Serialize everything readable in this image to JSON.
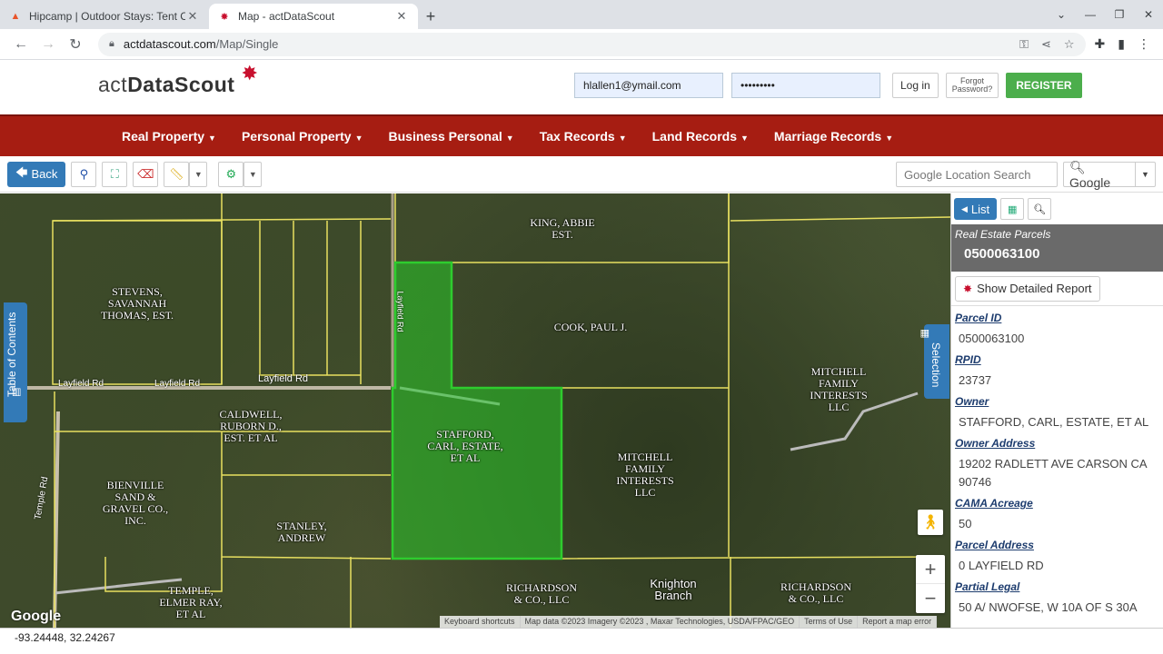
{
  "browser": {
    "tabs": [
      {
        "title": "Hipcamp | Outdoor Stays: Tent C",
        "active": false
      },
      {
        "title": "Map - actDataScout",
        "active": true
      }
    ],
    "url_host": "actdatascout.com",
    "url_path": "/Map/Single"
  },
  "site": {
    "logo_prefix": "act",
    "logo_main": "DataScout",
    "login": {
      "email_value": "hlallen1@ymail.com",
      "password_value": "•••••••••",
      "login_label": "Log in",
      "forgot_line1": "Forgot",
      "forgot_line2": "Password?",
      "register_label": "REGISTER"
    },
    "nav": [
      "Real Property",
      "Personal Property",
      "Business Personal",
      "Tax Records",
      "Land Records",
      "Marriage Records"
    ]
  },
  "toolbar": {
    "back_label": "Back",
    "location_search_placeholder": "Google Location Search",
    "search_engine_label": "Google"
  },
  "map": {
    "parcels": [
      {
        "name": "KING, ABBIE\nEST."
      },
      {
        "name": "STEVENS,\nSAVANNAH\nTHOMAS, EST."
      },
      {
        "name": "COOK, PAUL J."
      },
      {
        "name": "MITCHELL\nFAMILY\nINTERESTS\nLLC"
      },
      {
        "name": "CALDWELL,\nRUBORN D.,\nEST. ET AL"
      },
      {
        "name": "STAFFORD,\nCARL, ESTATE,\nET AL"
      },
      {
        "name": "MITCHELL\nFAMILY\nINTERESTS\nLLC"
      },
      {
        "name": "BIENVILLE\nSAND &\nGRAVEL CO.,\nINC."
      },
      {
        "name": "STANLEY,\nANDREW"
      },
      {
        "name": "TEMPLE,\nELMER RAY,\nET AL"
      },
      {
        "name": "RICHARDSON\n& CO., LLC"
      },
      {
        "name": "Knighton\nBranch"
      },
      {
        "name": "RICHARDSON\n& CO., LLC"
      }
    ],
    "roads": [
      "Layfield Rd",
      "Layfield Rd",
      "Layfield Rd",
      "Layfield Rd",
      "Temple Rd"
    ],
    "toc_label": "Table of Contents",
    "selection_label": "Selection",
    "google_logo": "Google",
    "attribution": [
      "Keyboard shortcuts",
      "Map data ©2023 Imagery ©2023 , Maxar Technologies, USDA/FPAC/GEO",
      "Terms of Use",
      "Report a map error"
    ],
    "coordinates": "-93.24448, 32.24267",
    "selected_color": "#2ecc2e",
    "parcel_line_color": "#e8e060"
  },
  "panel": {
    "list_label": "List",
    "category": "Real Estate Parcels",
    "parcel_id": "0500063100",
    "report_label": "Show Detailed Report",
    "fields": [
      {
        "label": "Parcel ID",
        "value": "0500063100"
      },
      {
        "label": "RPID",
        "value": "23737"
      },
      {
        "label": "Owner",
        "value": "STAFFORD, CARL, ESTATE, ET AL"
      },
      {
        "label": "Owner Address",
        "value": "19202 RADLETT AVE CARSON CA 90746"
      },
      {
        "label": "CAMA Acreage",
        "value": "50"
      },
      {
        "label": "Parcel Address",
        "value": "0 LAYFIELD RD"
      },
      {
        "label": "Partial Legal",
        "value": "50 A/ NWOFSE, W 10A OF S 30A"
      }
    ]
  }
}
